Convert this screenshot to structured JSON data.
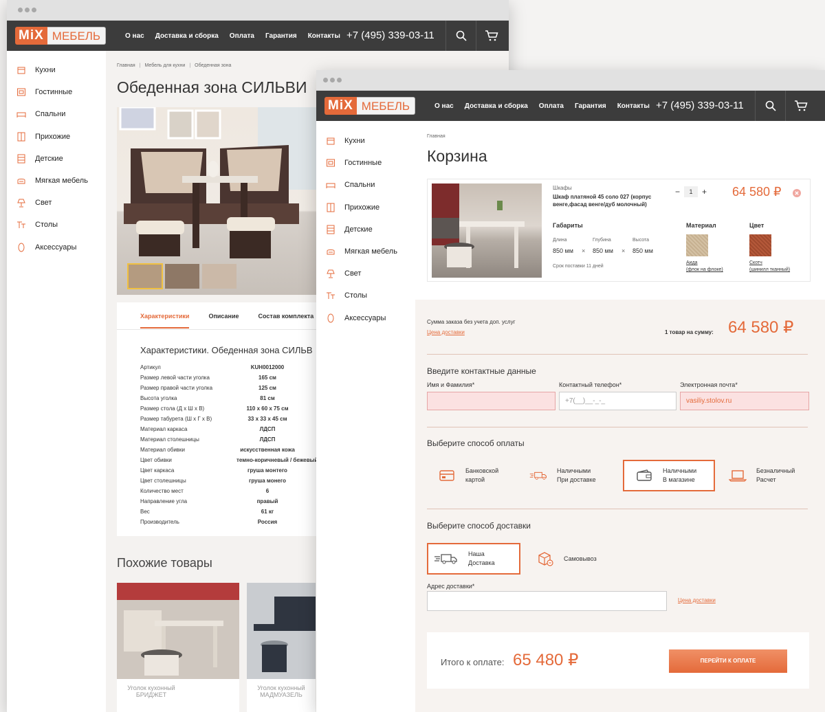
{
  "header": {
    "logo_mix": "MiX",
    "logo_text": "МЕБЕЛЬ",
    "nav": [
      "О нас",
      "Доставка и сборка",
      "Оплата",
      "Гарантия",
      "Контакты"
    ],
    "phone": "+7 (495) 339-03-11"
  },
  "sidebar": {
    "items": [
      {
        "label": "Кухни",
        "icon": "kitchen-icon"
      },
      {
        "label": "Гостинные",
        "icon": "living-room-icon"
      },
      {
        "label": "Спальни",
        "icon": "bed-icon"
      },
      {
        "label": "Прихожие",
        "icon": "hallway-icon"
      },
      {
        "label": "Детские",
        "icon": "kids-room-icon"
      },
      {
        "label": "Мягкая мебель",
        "icon": "sofa-icon"
      },
      {
        "label": "Свет",
        "icon": "lamp-icon"
      },
      {
        "label": "Столы",
        "icon": "table-icon"
      },
      {
        "label": "Аксессуары",
        "icon": "mirror-icon"
      }
    ]
  },
  "product_page": {
    "breadcrumb": [
      "Главная",
      "Мебель для кухни",
      "Обеденная зона"
    ],
    "title": "Обеденная зона СИЛЬВИ",
    "tabs": [
      "Характеристики",
      "Описание",
      "Состав комплекта"
    ],
    "spec_title": "Характеристики. Обеденная зона СИЛЬВ",
    "specs": [
      {
        "k": "Артикул",
        "v": "KUH0012000"
      },
      {
        "k": "Размер левой части уголка",
        "v": "165 см"
      },
      {
        "k": "Размер правой части уголка",
        "v": "125 см"
      },
      {
        "k": "Высота уголка",
        "v": "81 см"
      },
      {
        "k": "Размер стола (Д х Ш х В)",
        "v": "110 x 60 x 75 см"
      },
      {
        "k": "Размер табурета (Ш х Г х В)",
        "v": "33 x 33 x 45 см"
      },
      {
        "k": "Материал каркаса",
        "v": "ЛДСП"
      },
      {
        "k": "Материал столешницы",
        "v": "ЛДСП"
      },
      {
        "k": "Материал обивки",
        "v": "искусственная кожа"
      },
      {
        "k": "Цвет обивки",
        "v": "темно-коричневый / бежевый"
      },
      {
        "k": "Цвет каркаса",
        "v": "груша монтего"
      },
      {
        "k": "Цвет столешницы",
        "v": "груша монего"
      },
      {
        "k": "Количество мест",
        "v": "6"
      },
      {
        "k": "Направление угла",
        "v": "правый"
      },
      {
        "k": "Вес",
        "v": "61 кг"
      },
      {
        "k": "Производитель",
        "v": "Россия"
      }
    ],
    "similar_title": "Похожие товары",
    "similar": [
      "Уголок кухонный\nБРИДЖЕТ",
      "Уголок кухонный\nМАДМУАЗЕЛЬ"
    ]
  },
  "cart_page": {
    "breadcrumb": "Главная",
    "title": "Корзина",
    "item": {
      "category": "Шкафы",
      "name_line1": "Шкаф платяной 45 соло 027 (корпус",
      "name_line2": "венге,фасад венге/дуб молочный)",
      "qty": "1",
      "price": "64 580 ₽",
      "dims_title": "Габариты",
      "dims": [
        {
          "label": "Длина",
          "value": "850 мм"
        },
        {
          "label": "Глубина",
          "value": "850 мм"
        },
        {
          "label": "Высота",
          "value": "850 мм"
        }
      ],
      "delivery_time": "Срок поставки 11 дней",
      "material_title": "Материал",
      "material_name": "Аида",
      "material_sub": "(флок на флоке)",
      "color_title": "Цвет",
      "color_name": "Скотч",
      "color_sub": "(шинилл тканный)"
    },
    "summary": {
      "label": "Сумма заказа без учета доп. услуг",
      "delivery_link": "Цена доставки",
      "count_label": "1 товар на сумму:",
      "sum": "64 580 ₽"
    },
    "contact": {
      "title": "Введите контактные данные",
      "name_label": "Имя и Фамилия*",
      "name_value": "",
      "phone_label": "Контактный телефон*",
      "phone_placeholder": "+7(__)__-_-_",
      "email_label": "Электронная почта*",
      "email_value": "vasiliy.stolov.ru"
    },
    "payment": {
      "title": "Выберите способ оплаты",
      "options": [
        {
          "l1": "Банковской",
          "l2": "картой",
          "icon": "credit-card-icon"
        },
        {
          "l1": "Наличными",
          "l2": "При доставке",
          "icon": "delivery-truck-icon"
        },
        {
          "l1": "Наличными",
          "l2": "В магазине",
          "icon": "wallet-icon"
        },
        {
          "l1": "Безналичный",
          "l2": "Расчет",
          "icon": "laptop-icon"
        }
      ],
      "selected": 2
    },
    "delivery": {
      "title": "Выберите способ доставки",
      "options": [
        {
          "l1": "Наша",
          "l2": "Доставка",
          "icon": "truck-icon"
        },
        {
          "l1": "Самовывоз",
          "l2": "",
          "icon": "box-pickup-icon"
        }
      ],
      "address_label": "Адрес доставки*",
      "price_link": "Цена доставки"
    },
    "total": {
      "label": "Итого к оплате:",
      "value": "65 480 ₽",
      "button": "ПЕРЕЙТИ К ОПЛАТЕ"
    }
  },
  "colors": {
    "accent": "#e46a3a",
    "header": "#3c3c3c",
    "error_bg": "#fbe1e1"
  }
}
